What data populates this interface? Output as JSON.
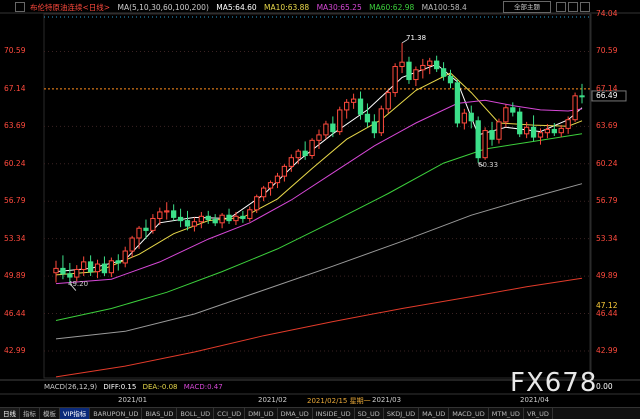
{
  "header": {
    "title": "布伦特原油连续<日线>",
    "ma_label": "MA(5,10,30,60,100,200)",
    "ma5": "MA5:64.60",
    "ma10": "MA10:63.88",
    "ma30": "MA30:65.25",
    "ma60": "MA60:62.98",
    "ma100": "MA100:58.4"
  },
  "toolbar": {
    "theme_label": "全部主题"
  },
  "macd": {
    "label": "MACD(26,12,9)",
    "diff": "DIFF:0.15",
    "dea": "DEA:-0.08",
    "macd": "MACD:0.47"
  },
  "tabs": [
    {
      "label": "日线"
    },
    {
      "label": "指标"
    },
    {
      "label": "模板"
    },
    {
      "label": "VIP指标"
    },
    {
      "label": "BARUPON_UD"
    },
    {
      "label": "BIAS_UD"
    },
    {
      "label": "BOLL_UD"
    },
    {
      "label": "CCI_UD"
    },
    {
      "label": "DMI_UD"
    },
    {
      "label": "DMA_UD"
    },
    {
      "label": "INSIDE_UD"
    },
    {
      "label": "SD_UD"
    },
    {
      "label": "SKDJ_UD"
    },
    {
      "label": "MA_UD"
    },
    {
      "label": "MACD_UD"
    },
    {
      "label": "MTM_UD"
    },
    {
      "label": "VR_UD"
    }
  ],
  "watermark": "FX678",
  "colors": {
    "up": "#ff4a3d",
    "down": "#3de08a",
    "ma5": "#ffffff",
    "ma10": "#e8d84a",
    "ma30": "#d648d6",
    "ma60": "#3ccf3c",
    "ma100": "#9a9a9a",
    "ma200": "#e23b2a",
    "price_line": "#ff8c1a"
  },
  "chart_data": {
    "type": "candlestick",
    "y_ticks": [
      74.04,
      70.59,
      67.14,
      63.69,
      60.24,
      56.79,
      53.34,
      49.89,
      46.44,
      42.99
    ],
    "y_ticks_left": [
      70.59,
      67.14,
      63.69,
      60.24,
      56.79,
      53.34,
      49.89,
      46.44,
      42.99
    ],
    "right_extra_labels": [
      "66.49",
      "47.12",
      "0.00"
    ],
    "ylim": [
      40.5,
      74.04
    ],
    "x_labels": [
      "2021/01",
      "2021/02",
      "2021/02/15 星期一",
      "2021/03",
      "2021/04"
    ],
    "annotations": [
      {
        "text": "71.38",
        "value": 71.38
      },
      {
        "text": "60.33",
        "value": 60.33
      },
      {
        "text": "49.20",
        "value": 49.2
      }
    ],
    "last_price": 66.49,
    "dashed_level": 67.14,
    "candles": [
      {
        "o": 50.2,
        "h": 51.3,
        "l": 49.3,
        "c": 50.6
      },
      {
        "o": 50.6,
        "h": 51.8,
        "l": 49.6,
        "c": 50.1
      },
      {
        "o": 50.1,
        "h": 51.1,
        "l": 49.2,
        "c": 49.8
      },
      {
        "o": 49.8,
        "h": 50.9,
        "l": 49.4,
        "c": 50.5
      },
      {
        "o": 50.5,
        "h": 51.7,
        "l": 49.9,
        "c": 51.2
      },
      {
        "o": 51.2,
        "h": 51.8,
        "l": 49.9,
        "c": 50.3
      },
      {
        "o": 50.3,
        "h": 51.4,
        "l": 49.7,
        "c": 51.0
      },
      {
        "o": 51.0,
        "h": 51.7,
        "l": 49.9,
        "c": 50.2
      },
      {
        "o": 50.2,
        "h": 51.6,
        "l": 49.8,
        "c": 51.3
      },
      {
        "o": 51.3,
        "h": 51.9,
        "l": 50.4,
        "c": 51.1
      },
      {
        "o": 51.1,
        "h": 52.6,
        "l": 50.7,
        "c": 52.2
      },
      {
        "o": 52.2,
        "h": 53.6,
        "l": 51.6,
        "c": 53.4
      },
      {
        "o": 53.4,
        "h": 54.5,
        "l": 52.4,
        "c": 54.3
      },
      {
        "o": 54.3,
        "h": 55.1,
        "l": 53.3,
        "c": 54.1
      },
      {
        "o": 54.1,
        "h": 55.6,
        "l": 53.8,
        "c": 55.2
      },
      {
        "o": 55.2,
        "h": 56.2,
        "l": 54.6,
        "c": 55.8
      },
      {
        "o": 55.8,
        "h": 56.7,
        "l": 55.1,
        "c": 55.9
      },
      {
        "o": 55.9,
        "h": 56.5,
        "l": 55.0,
        "c": 55.3
      },
      {
        "o": 55.3,
        "h": 56.1,
        "l": 54.4,
        "c": 55.0
      },
      {
        "o": 55.0,
        "h": 55.9,
        "l": 54.1,
        "c": 54.5
      },
      {
        "o": 54.5,
        "h": 55.3,
        "l": 54.0,
        "c": 54.9
      },
      {
        "o": 54.9,
        "h": 55.8,
        "l": 54.3,
        "c": 55.4
      },
      {
        "o": 55.4,
        "h": 55.9,
        "l": 54.7,
        "c": 55.1
      },
      {
        "o": 55.1,
        "h": 55.6,
        "l": 54.5,
        "c": 54.8
      },
      {
        "o": 54.8,
        "h": 55.7,
        "l": 54.3,
        "c": 55.5
      },
      {
        "o": 55.5,
        "h": 56.1,
        "l": 54.7,
        "c": 55.0
      },
      {
        "o": 55.0,
        "h": 55.8,
        "l": 54.6,
        "c": 55.4
      },
      {
        "o": 55.4,
        "h": 55.9,
        "l": 54.8,
        "c": 55.2
      },
      {
        "o": 55.2,
        "h": 56.3,
        "l": 54.9,
        "c": 56.0
      },
      {
        "o": 56.0,
        "h": 57.4,
        "l": 55.7,
        "c": 57.2
      },
      {
        "o": 57.2,
        "h": 58.2,
        "l": 56.8,
        "c": 58.0
      },
      {
        "o": 58.0,
        "h": 58.7,
        "l": 57.3,
        "c": 58.5
      },
      {
        "o": 58.5,
        "h": 59.4,
        "l": 58.0,
        "c": 59.1
      },
      {
        "o": 59.1,
        "h": 60.2,
        "l": 58.6,
        "c": 60.0
      },
      {
        "o": 60.0,
        "h": 61.1,
        "l": 59.5,
        "c": 60.8
      },
      {
        "o": 60.8,
        "h": 61.6,
        "l": 60.2,
        "c": 61.4
      },
      {
        "o": 61.4,
        "h": 62.3,
        "l": 60.6,
        "c": 61.0
      },
      {
        "o": 61.0,
        "h": 62.6,
        "l": 60.7,
        "c": 62.4
      },
      {
        "o": 62.4,
        "h": 63.4,
        "l": 61.6,
        "c": 62.9
      },
      {
        "o": 62.9,
        "h": 64.2,
        "l": 62.5,
        "c": 63.9
      },
      {
        "o": 63.9,
        "h": 64.6,
        "l": 62.7,
        "c": 63.2
      },
      {
        "o": 63.2,
        "h": 65.5,
        "l": 62.9,
        "c": 65.2
      },
      {
        "o": 65.2,
        "h": 66.2,
        "l": 64.4,
        "c": 65.9
      },
      {
        "o": 65.9,
        "h": 66.7,
        "l": 65.3,
        "c": 66.2
      },
      {
        "o": 66.2,
        "h": 66.9,
        "l": 64.3,
        "c": 64.8
      },
      {
        "o": 64.8,
        "h": 65.8,
        "l": 63.6,
        "c": 64.1
      },
      {
        "o": 64.1,
        "h": 64.8,
        "l": 62.6,
        "c": 63.1
      },
      {
        "o": 63.1,
        "h": 65.6,
        "l": 62.8,
        "c": 65.3
      },
      {
        "o": 65.3,
        "h": 67.1,
        "l": 64.9,
        "c": 66.8
      },
      {
        "o": 66.8,
        "h": 69.5,
        "l": 66.4,
        "c": 69.2
      },
      {
        "o": 69.2,
        "h": 71.38,
        "l": 68.6,
        "c": 69.6
      },
      {
        "o": 69.6,
        "h": 70.1,
        "l": 67.6,
        "c": 68.0
      },
      {
        "o": 68.0,
        "h": 69.2,
        "l": 67.4,
        "c": 68.9
      },
      {
        "o": 68.9,
        "h": 69.9,
        "l": 68.1,
        "c": 69.3
      },
      {
        "o": 69.3,
        "h": 70.0,
        "l": 68.5,
        "c": 69.7
      },
      {
        "o": 69.7,
        "h": 70.2,
        "l": 68.7,
        "c": 69.0
      },
      {
        "o": 69.0,
        "h": 69.6,
        "l": 67.9,
        "c": 68.3
      },
      {
        "o": 68.3,
        "h": 68.9,
        "l": 67.2,
        "c": 67.7
      },
      {
        "o": 67.7,
        "h": 68.0,
        "l": 63.6,
        "c": 64.0
      },
      {
        "o": 64.0,
        "h": 65.3,
        "l": 63.4,
        "c": 64.9
      },
      {
        "o": 64.9,
        "h": 65.6,
        "l": 63.5,
        "c": 64.2
      },
      {
        "o": 64.2,
        "h": 64.6,
        "l": 60.33,
        "c": 60.8
      },
      {
        "o": 60.8,
        "h": 63.6,
        "l": 60.6,
        "c": 63.3
      },
      {
        "o": 63.3,
        "h": 64.1,
        "l": 61.9,
        "c": 62.5
      },
      {
        "o": 62.5,
        "h": 64.4,
        "l": 62.1,
        "c": 64.1
      },
      {
        "o": 64.1,
        "h": 65.7,
        "l": 63.6,
        "c": 65.4
      },
      {
        "o": 65.4,
        "h": 65.9,
        "l": 64.6,
        "c": 65.0
      },
      {
        "o": 65.0,
        "h": 65.4,
        "l": 62.7,
        "c": 63.0
      },
      {
        "o": 63.0,
        "h": 64.1,
        "l": 62.6,
        "c": 63.6
      },
      {
        "o": 63.6,
        "h": 64.7,
        "l": 62.3,
        "c": 62.7
      },
      {
        "o": 62.7,
        "h": 63.5,
        "l": 62.0,
        "c": 63.1
      },
      {
        "o": 63.1,
        "h": 63.9,
        "l": 62.6,
        "c": 63.4
      },
      {
        "o": 63.4,
        "h": 64.0,
        "l": 62.8,
        "c": 63.1
      },
      {
        "o": 63.1,
        "h": 63.8,
        "l": 62.7,
        "c": 63.5
      },
      {
        "o": 63.5,
        "h": 64.6,
        "l": 63.0,
        "c": 64.3
      },
      {
        "o": 64.3,
        "h": 66.8,
        "l": 64.1,
        "c": 66.5
      },
      {
        "o": 66.5,
        "h": 67.6,
        "l": 65.8,
        "c": 66.49
      }
    ],
    "ma_series": [
      {
        "name": "MA5",
        "color_key": "ma5",
        "points": [
          [
            0,
            50.3
          ],
          [
            5,
            50.6
          ],
          [
            10,
            51.4
          ],
          [
            15,
            54.8
          ],
          [
            20,
            55.3
          ],
          [
            25,
            55.2
          ],
          [
            30,
            57.4
          ],
          [
            35,
            60.5
          ],
          [
            40,
            63.0
          ],
          [
            45,
            65.2
          ],
          [
            50,
            68.2
          ],
          [
            55,
            69.4
          ],
          [
            58,
            67.8
          ],
          [
            61,
            62.9
          ],
          [
            65,
            63.6
          ],
          [
            70,
            63.2
          ],
          [
            74,
            64.3
          ],
          [
            76,
            65.4
          ]
        ]
      },
      {
        "name": "MA10",
        "color_key": "ma10",
        "points": [
          [
            0,
            50.0
          ],
          [
            6,
            50.3
          ],
          [
            12,
            51.9
          ],
          [
            17,
            53.8
          ],
          [
            22,
            55.0
          ],
          [
            27,
            55.3
          ],
          [
            32,
            57.0
          ],
          [
            37,
            59.8
          ],
          [
            42,
            62.5
          ],
          [
            47,
            64.3
          ],
          [
            52,
            67.0
          ],
          [
            57,
            68.6
          ],
          [
            60,
            66.8
          ],
          [
            64,
            64.0
          ],
          [
            69,
            63.8
          ],
          [
            74,
            63.7
          ],
          [
            76,
            64.2
          ]
        ]
      },
      {
        "name": "MA30",
        "color_key": "ma30",
        "points": [
          [
            0,
            49.2
          ],
          [
            8,
            49.6
          ],
          [
            15,
            51.2
          ],
          [
            22,
            53.3
          ],
          [
            28,
            54.8
          ],
          [
            34,
            56.9
          ],
          [
            40,
            59.4
          ],
          [
            46,
            61.9
          ],
          [
            52,
            64.0
          ],
          [
            58,
            65.8
          ],
          [
            62,
            66.1
          ],
          [
            66,
            65.6
          ],
          [
            70,
            65.2
          ],
          [
            74,
            65.1
          ],
          [
            76,
            65.3
          ]
        ]
      },
      {
        "name": "MA60",
        "color_key": "ma60",
        "points": [
          [
            0,
            45.8
          ],
          [
            8,
            46.9
          ],
          [
            16,
            48.4
          ],
          [
            24,
            50.3
          ],
          [
            32,
            52.4
          ],
          [
            40,
            54.9
          ],
          [
            48,
            57.5
          ],
          [
            56,
            60.3
          ],
          [
            62,
            61.6
          ],
          [
            68,
            62.2
          ],
          [
            76,
            63.0
          ]
        ]
      },
      {
        "name": "MA100",
        "color_key": "ma100",
        "points": [
          [
            0,
            44.1
          ],
          [
            10,
            44.8
          ],
          [
            20,
            46.4
          ],
          [
            30,
            48.6
          ],
          [
            40,
            50.8
          ],
          [
            50,
            53.1
          ],
          [
            60,
            55.5
          ],
          [
            68,
            57.0
          ],
          [
            76,
            58.4
          ]
        ]
      },
      {
        "name": "MA200",
        "color_key": "ma200",
        "points": [
          [
            0,
            40.6
          ],
          [
            10,
            41.6
          ],
          [
            20,
            42.9
          ],
          [
            30,
            44.4
          ],
          [
            40,
            45.7
          ],
          [
            50,
            46.9
          ],
          [
            60,
            48.0
          ],
          [
            68,
            48.9
          ],
          [
            76,
            49.7
          ]
        ]
      }
    ]
  }
}
